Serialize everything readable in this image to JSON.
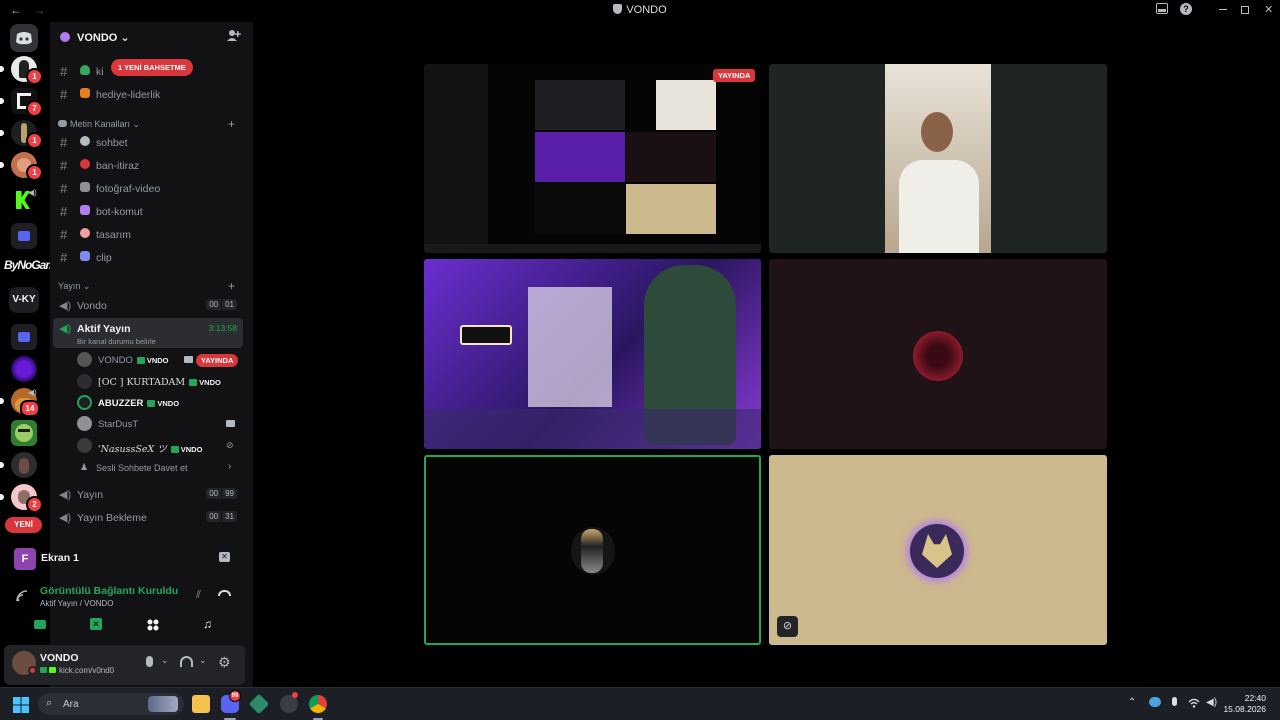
{
  "window": {
    "title": "VONDO",
    "back": "←",
    "forward": "→",
    "inbox_icon": "inbox-icon",
    "help": "?"
  },
  "rail": {
    "badges": [
      "1",
      "7",
      "1",
      "1",
      "1",
      "14",
      "2"
    ],
    "bynogame": "ByNoGame",
    "vky": "V-KY",
    "new_label": "YENİ"
  },
  "server": {
    "name": "VONDO",
    "chevron": "⌄"
  },
  "banner": "1 YENİ BAHSETME",
  "channels_top": [
    {
      "name": "ki",
      "emoji_color": "#3ba55c"
    },
    {
      "name": "hediye-liderlik",
      "emoji_color": "#e67e22"
    }
  ],
  "text_category": {
    "name": "Metin Kanalları",
    "chevron": "⌄",
    "plus": "+"
  },
  "text_channels": [
    {
      "name": "sohbet",
      "emoji_color": "#b5bac1"
    },
    {
      "name": "ban-itiraz",
      "emoji_color": "#da373c"
    },
    {
      "name": "fotoğraf-video",
      "emoji_color": "#8e9297"
    },
    {
      "name": "bot-komut",
      "emoji_color": "#b07cf0"
    },
    {
      "name": "tasarım",
      "emoji_color": "#f0a0a0"
    },
    {
      "name": "clip",
      "emoji_color": "#7c8cf0"
    }
  ],
  "voice_category": {
    "name": "Yayın",
    "chevron": "⌄",
    "plus": "+"
  },
  "voice_channels": [
    {
      "name": "Vondo",
      "count_a": "00",
      "count_b": "01"
    },
    {
      "name": "Aktif Yayın",
      "timer": "3:13:58",
      "status": "Bir kanal durumu belirle"
    },
    {
      "name": "Yayın",
      "count_a": "00",
      "count_b": "99"
    },
    {
      "name": "Yayın Bekleme",
      "count_a": "00",
      "count_b": "31"
    }
  ],
  "members": [
    {
      "name": "VONDO",
      "tag": "VNDO",
      "live": "YAYINDA",
      "color": "#949ba4"
    },
    {
      "name": "[OC ] KURTADAM",
      "tag": "VNDO",
      "color": "#dbdee1"
    },
    {
      "name": "ABUZZER",
      "tag": "VNDO",
      "color": "#f2f3f5"
    },
    {
      "name": "StarDusT",
      "tag": "",
      "color": "#949ba4"
    },
    {
      "name": "'NasussSeX ツ",
      "tag": "VNDO",
      "color": "#dbdee1"
    }
  ],
  "invite_row": "Sesli Sohbete Davet et",
  "screen_panel": {
    "avatar_letter": "F",
    "label": "Ekran 1"
  },
  "connection": {
    "status": "Görüntülü Bağlantı Kuruldu",
    "location": "Aktif Yayın / VONDO"
  },
  "user": {
    "name": "VONDO",
    "status": "kick.com/v0nd0"
  },
  "stage": {
    "live_badge": "YAYINDA"
  },
  "taskbar": {
    "search_placeholder": "Ara",
    "discord_badge": "99",
    "time": "22:40",
    "date": "15.08.2026"
  },
  "colors": {
    "accent_red": "#da373c",
    "green": "#23a55a",
    "sidebar_bg": "#121214",
    "rail_bg": "#000000"
  }
}
